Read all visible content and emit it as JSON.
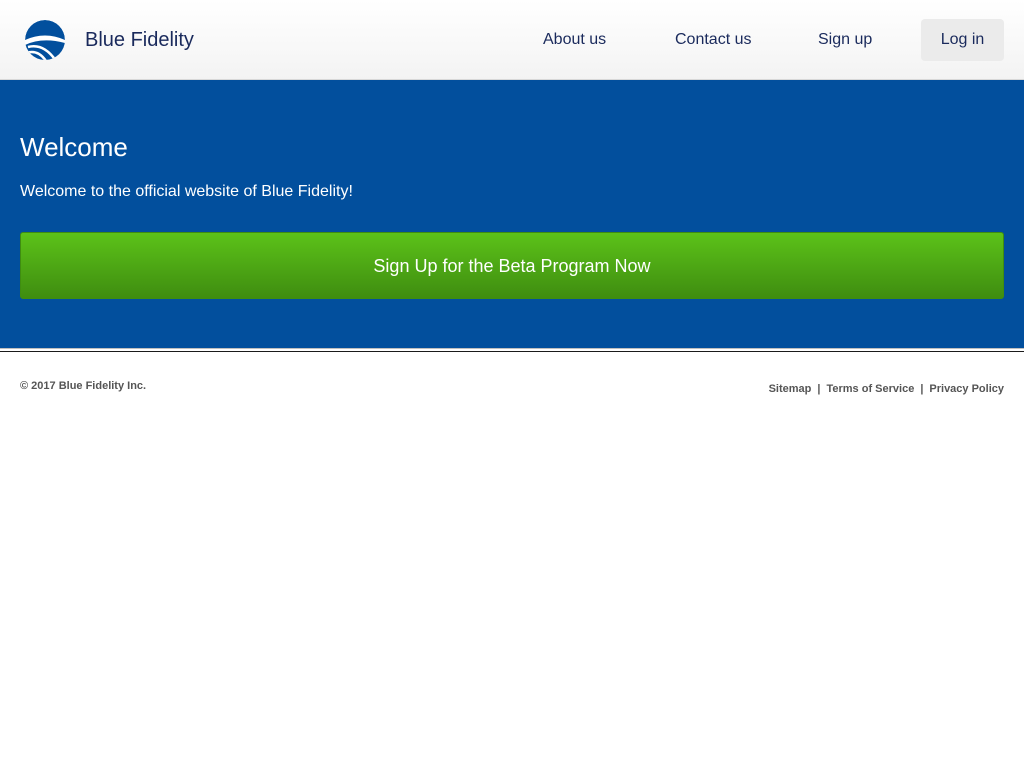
{
  "header": {
    "brand_name": "Blue Fidelity",
    "logo_icon": "blue-fidelity-logo-icon",
    "nav": {
      "about": "About us",
      "contact": "Contact us",
      "signup": "Sign up",
      "login": "Log in"
    }
  },
  "hero": {
    "title": "Welcome",
    "text": "Welcome to the official website of Blue Fidelity!",
    "cta_label": "Sign Up for the Beta Program Now"
  },
  "footer": {
    "copyright": "© 2017 Blue Fidelity Inc.",
    "links": {
      "sitemap": "Sitemap",
      "terms": "Terms of Service",
      "privacy": "Privacy Policy"
    },
    "separator": "|"
  },
  "colors": {
    "brand_blue": "#024f9d",
    "nav_text": "#1a2a5c",
    "cta_green_top": "#5cc219",
    "cta_green_bottom": "#3f8d10"
  }
}
